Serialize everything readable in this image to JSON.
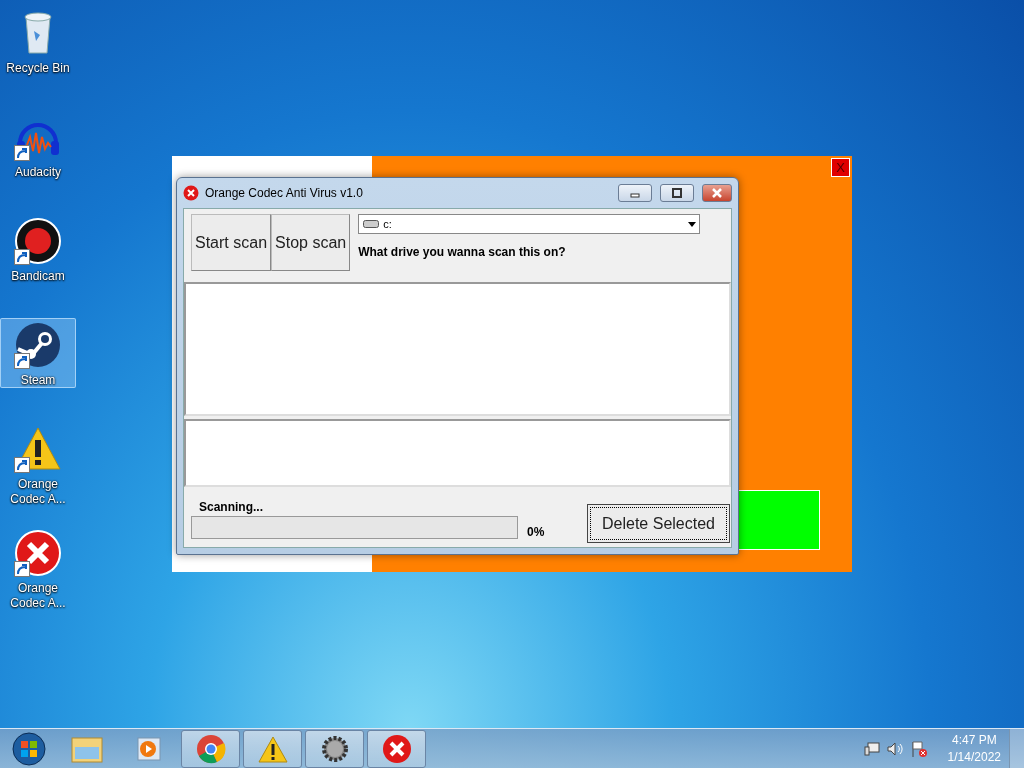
{
  "desktop_icons": [
    {
      "label": "Recycle Bin",
      "shortcut": false,
      "selected": false
    },
    {
      "label": "Audacity",
      "shortcut": true,
      "selected": false
    },
    {
      "label": "Bandicam",
      "shortcut": true,
      "selected": false
    },
    {
      "label": "Steam",
      "shortcut": true,
      "selected": true
    },
    {
      "label": "Orange Codec A...",
      "shortcut": true,
      "selected": false
    },
    {
      "label": "Orange Codec A...",
      "shortcut": true,
      "selected": false
    }
  ],
  "background_window": {
    "close_label": "X"
  },
  "window": {
    "title": "Orange Codec Anti Virus v1.0",
    "buttons": [
      "Start scan",
      "Stop scan"
    ],
    "drive_dropdown": {
      "value": "c:"
    },
    "drive_prompt": "What drive you wanna scan this on?",
    "status": "Scanning...",
    "progress": {
      "level": 0,
      "reading": "0%"
    },
    "delete_button": {
      "label": "Delete Selected",
      "focused": true
    }
  },
  "taskbar": {
    "items": [
      {
        "running": false
      },
      {
        "running": false
      },
      {
        "running": true
      },
      {
        "running": true
      },
      {
        "running": true
      },
      {
        "running": true
      }
    ],
    "clock": {
      "time": "4:47 PM",
      "date": "1/14/2022"
    }
  }
}
